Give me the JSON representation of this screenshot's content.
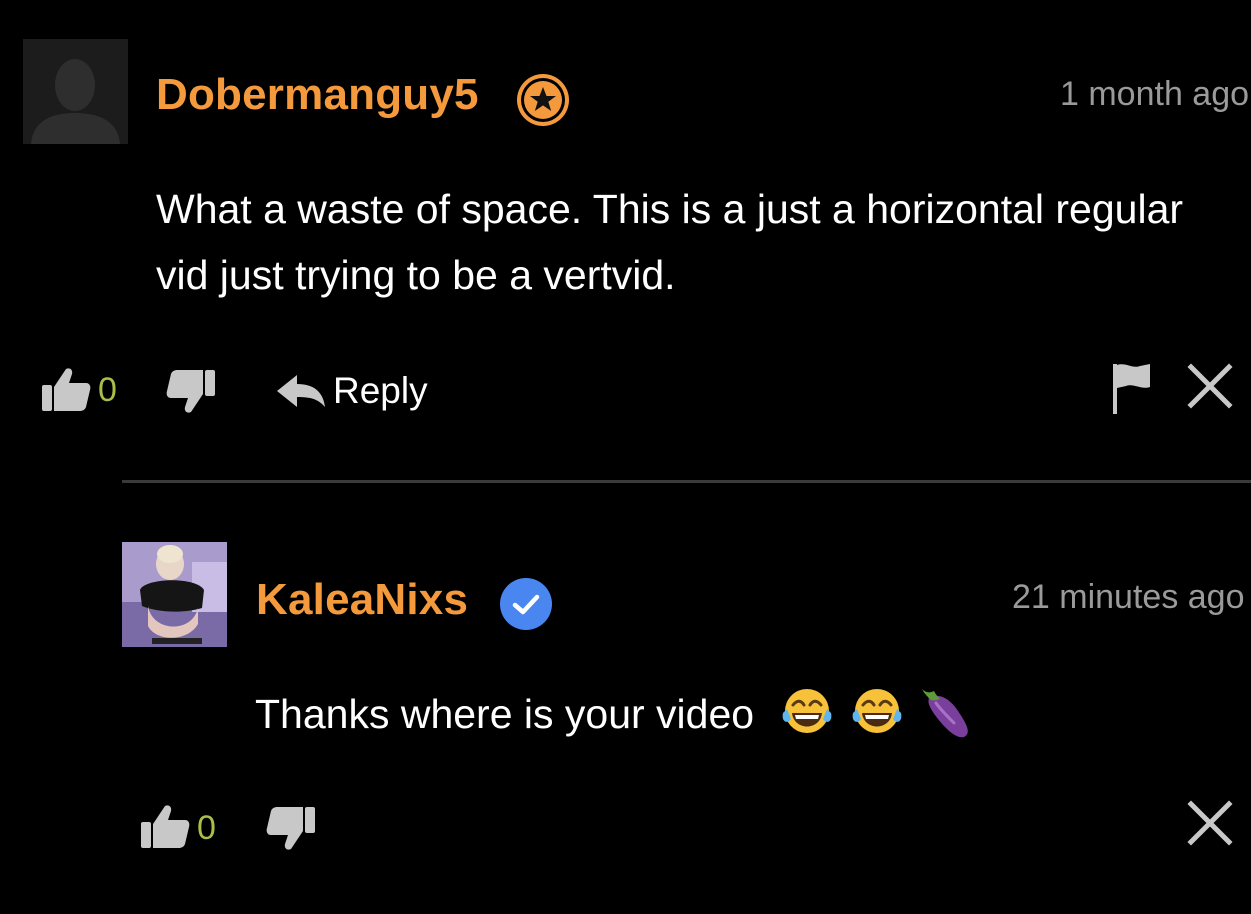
{
  "comments": [
    {
      "username": "Dobermanguy5",
      "badge": "star-badge-icon",
      "timestamp": "1 month ago",
      "text": "What a waste of space. This is a just a horizontal regular vid just trying to be a vertvid.",
      "likes": "0",
      "reply_label": "Reply",
      "avatar": "default-avatar-silhouette"
    },
    {
      "username": "KaleaNixs",
      "badge": "verified-badge-icon",
      "timestamp": "21 minutes ago",
      "text": "Thanks where is your video",
      "emojis": [
        "tears-of-joy-emoji",
        "tears-of-joy-emoji",
        "eggplant-emoji"
      ],
      "likes": "0",
      "avatar": "user-photo"
    }
  ],
  "colors": {
    "background": "#000000",
    "username": "#f49a3c",
    "verified_badge": "#4a86f0",
    "star_badge": "#f49a3c",
    "timestamp": "#9a9a9a",
    "like_count": "#a9bf4a",
    "icon": "#c8c8c8",
    "divider": "#3a3a3a"
  }
}
